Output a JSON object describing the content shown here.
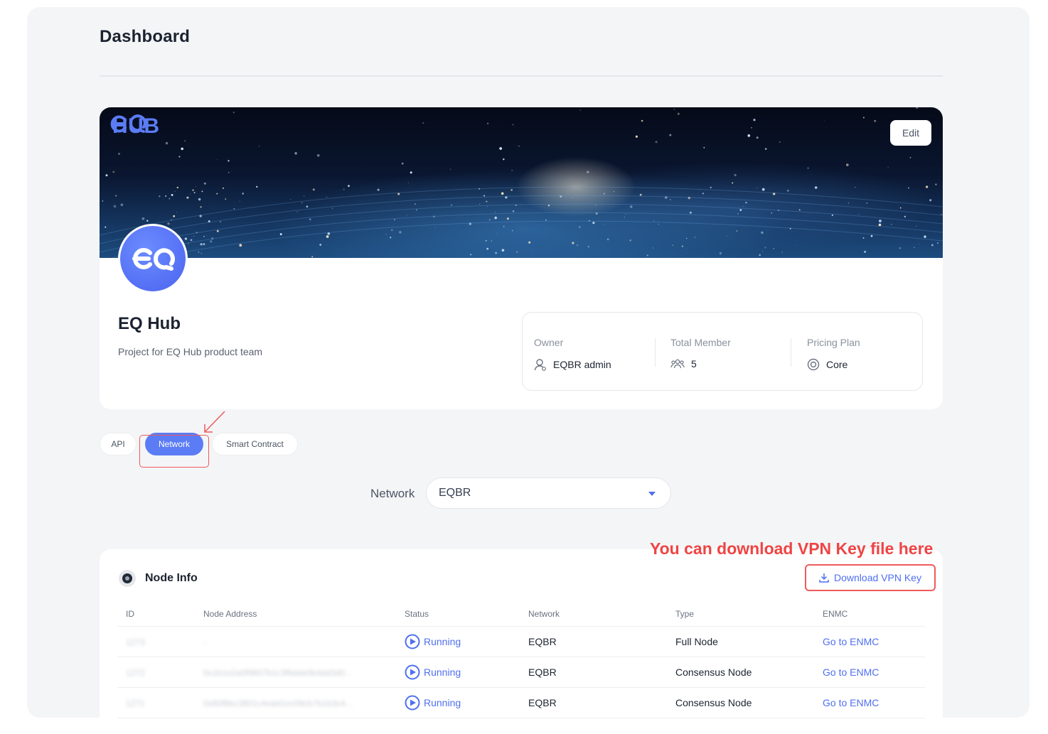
{
  "page": {
    "title": "Dashboard"
  },
  "project": {
    "brand": "HUB",
    "edit_label": "Edit",
    "name": "EQ Hub",
    "description": "Project for EQ Hub product team",
    "owner_label": "Owner",
    "owner_value": "EQBR admin",
    "members_label": "Total Member",
    "members_value": "5",
    "plan_label": "Pricing Plan",
    "plan_value": "Core"
  },
  "tabs": [
    {
      "label": "API",
      "active": false
    },
    {
      "label": "Network",
      "active": true
    },
    {
      "label": "Smart Contract",
      "active": false
    }
  ],
  "network": {
    "label": "Network",
    "selected": "EQBR"
  },
  "annotation": "You can download VPN Key file here",
  "node_info": {
    "title": "Node Info",
    "download_label": "Download VPN Key",
    "columns": [
      "ID",
      "Node Address",
      "Status",
      "Network",
      "Type",
      "ENMC"
    ],
    "rows": [
      {
        "id": "1273",
        "address": "-",
        "status": "Running",
        "network": "EQBR",
        "type": "Full Node",
        "enmc": "Go to ENMC"
      },
      {
        "id": "1272",
        "address": "0x1b1e2a0f9807b1c3f6dde0b4dd3d0...",
        "status": "Running",
        "network": "EQBR",
        "type": "Consensus Node",
        "enmc": "Go to ENMC"
      },
      {
        "id": "1271",
        "address": "0x80f6bc3801c4edd1ec09cb7b1b3c4...",
        "status": "Running",
        "network": "EQBR",
        "type": "Consensus Node",
        "enmc": "Go to ENMC"
      }
    ]
  },
  "colors": {
    "accent": "#5b7cf5",
    "link": "#4f6ff0",
    "annotation": "#ef4444",
    "page_bg": "#f4f5f7"
  }
}
